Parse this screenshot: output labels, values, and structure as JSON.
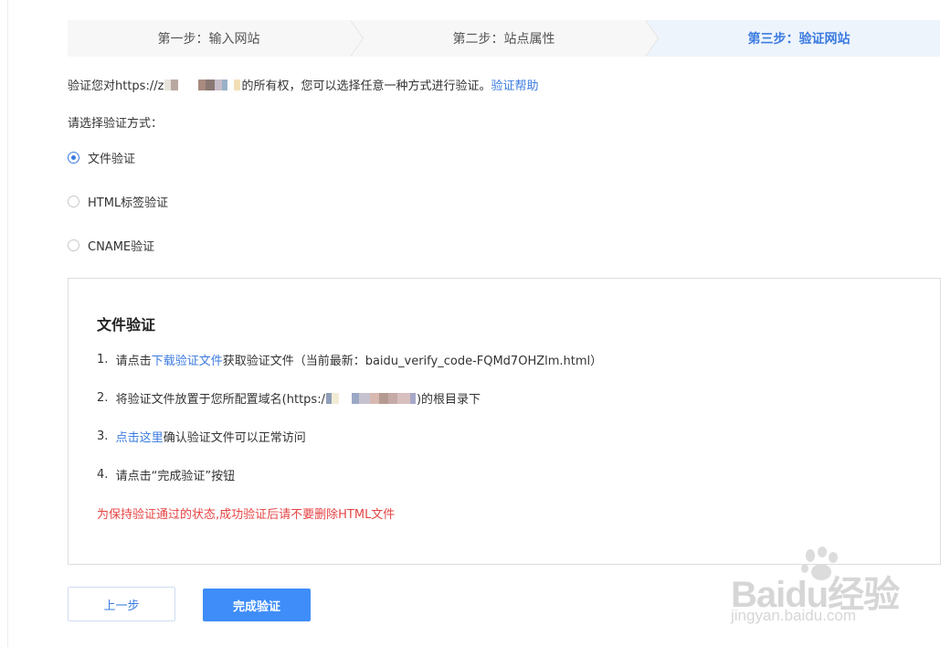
{
  "steps": [
    {
      "label": "第一步：输入网站",
      "active": false
    },
    {
      "label": "第二步：站点属性",
      "active": false
    },
    {
      "label": "第三步：验证网站",
      "active": true
    }
  ],
  "intro": {
    "prefix": "验证您对https://z",
    "suffix": "的所有权，您可以选择任意一种方式进行验证。",
    "help_link": "验证帮助"
  },
  "choose_label": "请选择验证方式：",
  "methods": [
    {
      "label": "文件验证",
      "checked": true
    },
    {
      "label": "HTML标签验证",
      "checked": false
    },
    {
      "label": "CNAME验证",
      "checked": false
    }
  ],
  "panel": {
    "title": "文件验证",
    "step1": {
      "num": "1.",
      "pre": "请点击",
      "link": "下载验证文件",
      "post": "获取验证文件（当前最新：baidu_verify_code-FQMd7OHZlm.html）"
    },
    "step2": {
      "num": "2.",
      "pre": "将验证文件放置于您所配置域名(https:/",
      "post": ")的根目录下"
    },
    "step3": {
      "num": "3.",
      "link": "点击这里",
      "post": "确认验证文件可以正常访问"
    },
    "step4": {
      "num": "4.",
      "text": "请点击“完成验证”按钮"
    },
    "warning": "为保持验证通过的状态,成功验证后请不要删除HTML文件"
  },
  "buttons": {
    "prev": "上一步",
    "done": "完成验证"
  },
  "watermark": {
    "logo": "Baidu经验",
    "url": "jingyan.baidu.com"
  },
  "colors": {
    "accent": "#3b7be0",
    "primary_button": "#3e8df8",
    "warning": "#e64444"
  }
}
